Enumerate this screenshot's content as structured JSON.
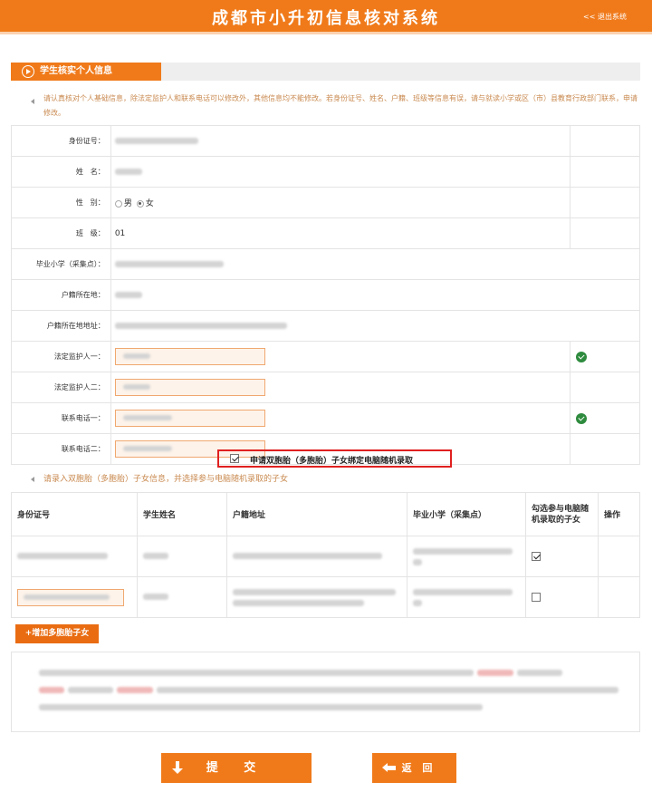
{
  "header": {
    "title": "成都市小升初信息核对系统",
    "logout": "<< 退出系统"
  },
  "section": {
    "title": "学生核实个人信息"
  },
  "notice": "请认真核对个人基础信息，除法定监护人和联系电话可以修改外，其他信息均不能修改。若身份证号、姓名、户籍、班级等信息有误，请与就读小学或区（市）县教育行政部门联系，申请修改。",
  "form": {
    "id_label": "身份证号：",
    "name_label": "姓　名：",
    "gender_label": "性　别：",
    "gender_male": "男",
    "gender_female": "女",
    "gender_selected": "女",
    "class_label": "班　级：",
    "class_value": "01",
    "school_label": "毕业小学（采集点）：",
    "hukou_label": "户籍所在地：",
    "hukou_addr_label": "户籍所在地地址：",
    "guardian1_label": "法定监护人一：",
    "guardian2_label": "法定监护人二：",
    "phone1_label": "联系电话一：",
    "phone2_label": "联系电话二："
  },
  "twin": {
    "checkbox_label": "申请双胞胎（多胞胎）子女绑定电脑随机录取",
    "checked": true,
    "note": "请录入双胞胎（多胞胎）子女信息，并选择参与电脑随机录取的子女",
    "columns": [
      "身份证号",
      "学生姓名",
      "户籍地址",
      "毕业小学（采集点）",
      "勾选参与电脑随机录取的子女",
      "操作"
    ],
    "rows": [
      {
        "selected": true
      },
      {
        "selected": false
      }
    ],
    "add_button": "+增加多胞胎子女"
  },
  "buttons": {
    "submit": "提 交",
    "back": "返 回"
  },
  "colors": {
    "brand_orange": "#f07a1a",
    "notice_text": "#c98a50",
    "ok_green": "#2e8b3e",
    "highlight_red": "#e02020"
  }
}
